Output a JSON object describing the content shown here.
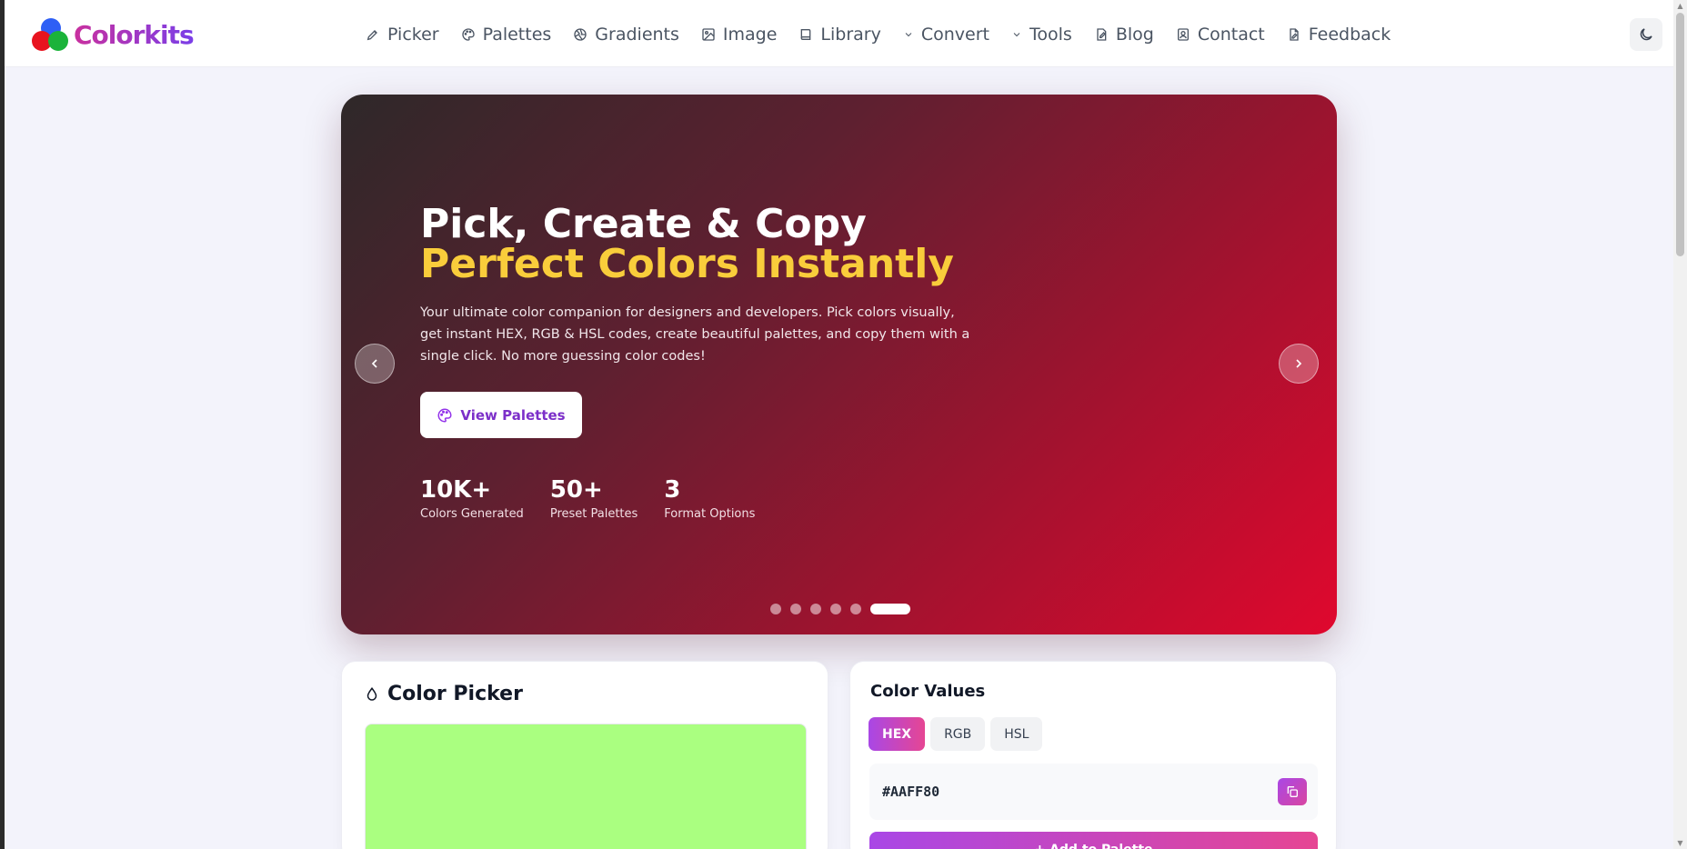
{
  "brand": {
    "name": "Colorkits"
  },
  "nav": {
    "items": [
      {
        "label": "Picker",
        "icon": "pen-icon"
      },
      {
        "label": "Palettes",
        "icon": "palette-icon"
      },
      {
        "label": "Gradients",
        "icon": "aperture-icon"
      },
      {
        "label": "Image",
        "icon": "image-icon"
      },
      {
        "label": "Library",
        "icon": "book-icon"
      },
      {
        "label": "Convert",
        "icon": "chevron-down-icon"
      },
      {
        "label": "Tools",
        "icon": "chevron-down-icon"
      },
      {
        "label": "Blog",
        "icon": "edit-icon"
      },
      {
        "label": "Contact",
        "icon": "contact-icon"
      },
      {
        "label": "Feedback",
        "icon": "file-edit-icon"
      }
    ],
    "theme_toggle_icon": "moon-icon"
  },
  "hero": {
    "title_line1": "Pick, Create & Copy",
    "title_line2": "Perfect Colors Instantly",
    "description": "Your ultimate color companion for designers and developers. Pick colors visually, get instant HEX, RGB & HSL codes, create beautiful palettes, and copy them with a single click. No more guessing color codes!",
    "cta_label": "View Palettes",
    "stats": [
      {
        "value": "10K+",
        "label": "Colors Generated"
      },
      {
        "value": "50+",
        "label": "Preset Palettes"
      },
      {
        "value": "3",
        "label": "Format Options"
      }
    ],
    "carousel": {
      "slides": 6,
      "active_index": 5
    }
  },
  "picker": {
    "title": "Color Picker",
    "current_color": "#AAFF80"
  },
  "values": {
    "title": "Color Values",
    "tabs": [
      "HEX",
      "RGB",
      "HSL"
    ],
    "active_tab": "HEX",
    "current_value": "#AAFF80",
    "add_label": "+ Add to Palette"
  },
  "colors": {
    "accent_purple": "#a947e6",
    "accent_pink": "#e64693",
    "hero_yellow": "#f9cd3b",
    "hero_red": "#e0082e"
  }
}
